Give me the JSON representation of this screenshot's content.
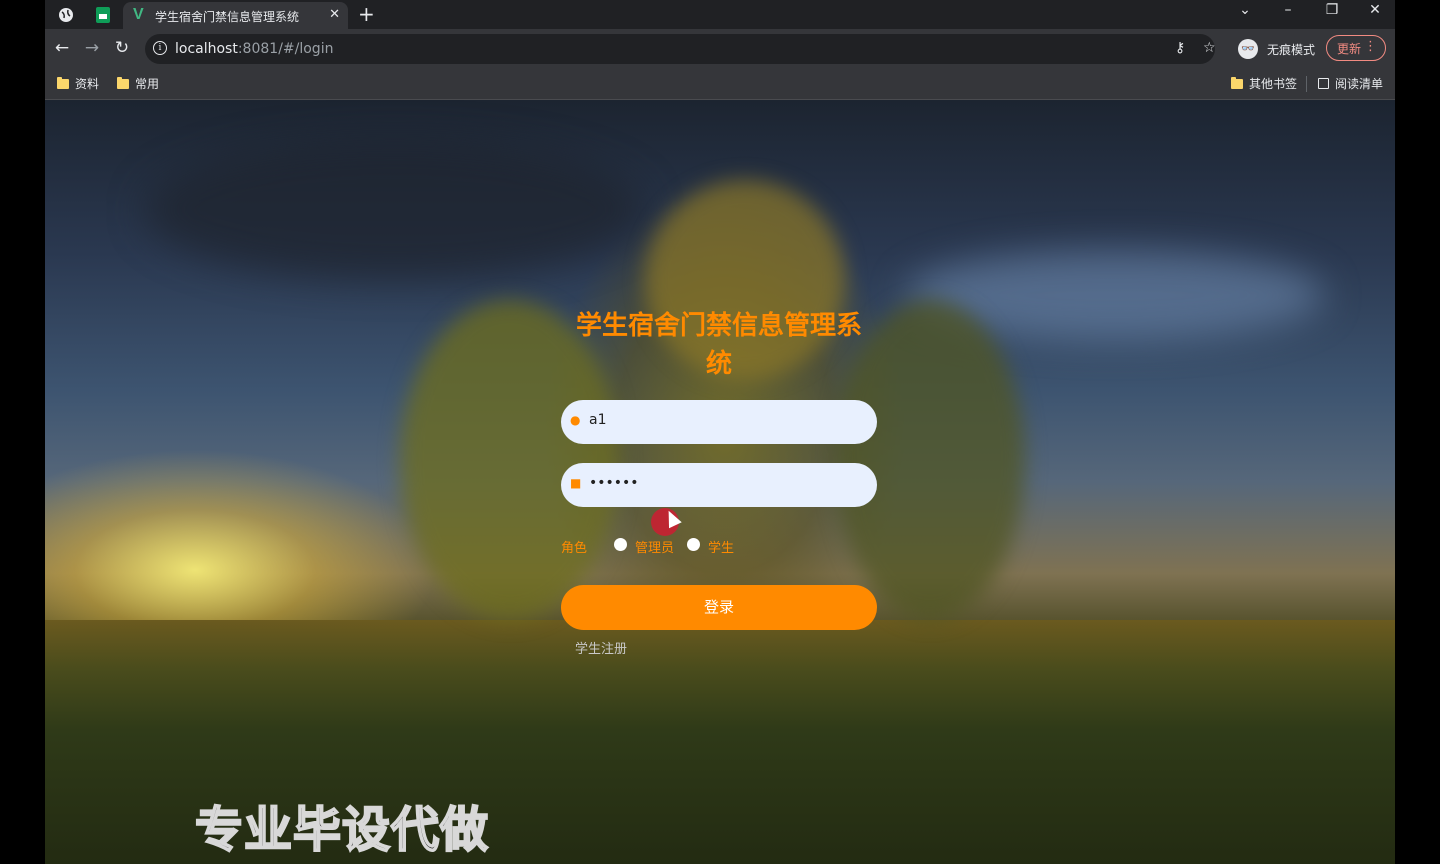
{
  "browser": {
    "tab": {
      "title": "学生宿舍门禁信息管理系统",
      "favicon": "V"
    },
    "url": {
      "host": "localhost",
      "rest": ":8081/#/login"
    },
    "incognito_label": "无痕模式",
    "update_label": "更新",
    "bookmarks_left": [
      "资料",
      "常用"
    ],
    "bookmarks_right": {
      "other": "其他书签",
      "reading": "阅读清单"
    }
  },
  "login": {
    "title": "学生宿舍门禁信息管理系统",
    "username_value": "a1",
    "password_value": "••••••",
    "role_label": "角色",
    "roles": [
      "管理员",
      "学生"
    ],
    "login_button": "登录",
    "register_link": "学生注册"
  },
  "overlay": {
    "watermark": "专业毕设代做"
  },
  "colors": {
    "accent": "#ff8a00",
    "field_bg": "#e8f0fe"
  }
}
